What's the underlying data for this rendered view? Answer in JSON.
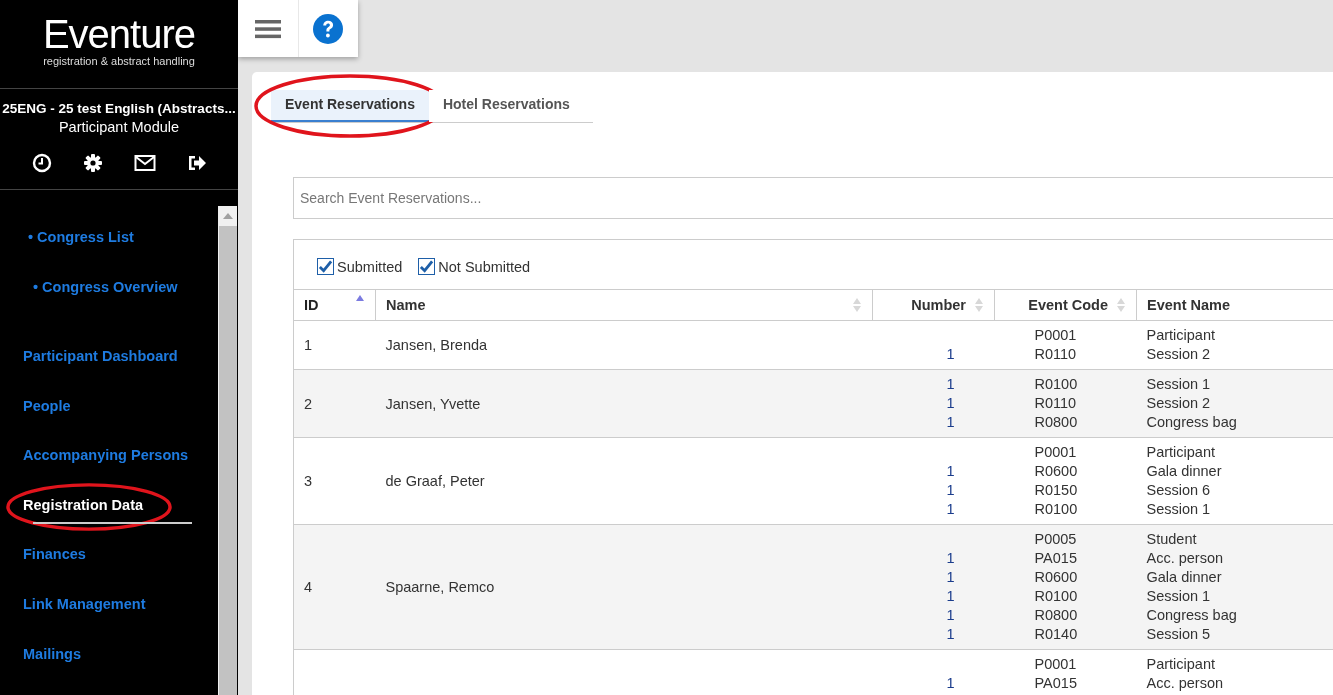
{
  "sidebar": {
    "logo": "Eventure",
    "tagline": "registration & abstract handling",
    "event_title": "25ENG - 25 test English (Abstracts...",
    "module": "Participant Module",
    "quick_links": [
      {
        "label": "• Congress List"
      },
      {
        "label": "• Congress Overview"
      }
    ],
    "nav": [
      {
        "label": "Participant Dashboard",
        "selected": false,
        "circled": false
      },
      {
        "label": "People",
        "selected": false,
        "circled": false
      },
      {
        "label": "Accompanying Persons",
        "selected": false,
        "circled": false
      },
      {
        "label": "Registration Data",
        "selected": true,
        "circled": true
      },
      {
        "label": "Finances",
        "selected": false,
        "circled": false
      },
      {
        "label": "Link Management",
        "selected": false,
        "circled": false
      },
      {
        "label": "Mailings",
        "selected": false,
        "circled": false
      }
    ]
  },
  "tabs": [
    {
      "label": "Event Reservations",
      "selected": true,
      "circled": true
    },
    {
      "label": "Hotel Reservations",
      "selected": false,
      "circled": false
    }
  ],
  "search": {
    "placeholder": "Search Event Reservations..."
  },
  "filters": [
    {
      "label": "Submitted",
      "checked": true
    },
    {
      "label": "Not Submitted",
      "checked": true
    }
  ],
  "table": {
    "columns": [
      {
        "label": "ID",
        "sortable": true,
        "sorted": true
      },
      {
        "label": "Name",
        "sortable": true,
        "sorted": false
      },
      {
        "label": "Number",
        "sortable": true,
        "sorted": false
      },
      {
        "label": "Event Code",
        "sortable": true,
        "sorted": false
      },
      {
        "label": "Event Name",
        "sortable": false,
        "sorted": false
      }
    ],
    "rows": [
      {
        "id": "1",
        "name": "Jansen, Brenda",
        "lines": [
          {
            "code": "P0001",
            "event": "Participant"
          },
          {
            "number": "1",
            "code": "R0110",
            "event": "Session 2"
          }
        ]
      },
      {
        "id": "2",
        "name": "Jansen, Yvette",
        "lines": [
          {
            "number": "1",
            "code": "R0100",
            "event": "Session 1"
          },
          {
            "number": "1",
            "code": "R0110",
            "event": "Session 2"
          },
          {
            "number": "1",
            "code": "R0800",
            "event": "Congress bag"
          }
        ]
      },
      {
        "id": "3",
        "name": "de Graaf, Peter",
        "lines": [
          {
            "code": "P0001",
            "event": "Participant"
          },
          {
            "number": "1",
            "code": "R0600",
            "event": "Gala dinner"
          },
          {
            "number": "1",
            "code": "R0150",
            "event": "Session 6"
          },
          {
            "number": "1",
            "code": "R0100",
            "event": "Session 1"
          }
        ]
      },
      {
        "id": "4",
        "name": "Spaarne, Remco",
        "lines": [
          {
            "code": "P0005",
            "event": "Student"
          },
          {
            "number": "1",
            "code": "PA015",
            "event": "Acc. person"
          },
          {
            "number": "1",
            "code": "R0600",
            "event": "Gala dinner"
          },
          {
            "number": "1",
            "code": "R0100",
            "event": "Session 1"
          },
          {
            "number": "1",
            "code": "R0800",
            "event": "Congress bag"
          },
          {
            "number": "1",
            "code": "R0140",
            "event": "Session 5"
          }
        ]
      },
      {
        "lines": [
          {
            "code": "P0001",
            "event": "Participant"
          },
          {
            "number": "1",
            "code": "PA015",
            "event": "Acc. person"
          }
        ]
      }
    ]
  }
}
